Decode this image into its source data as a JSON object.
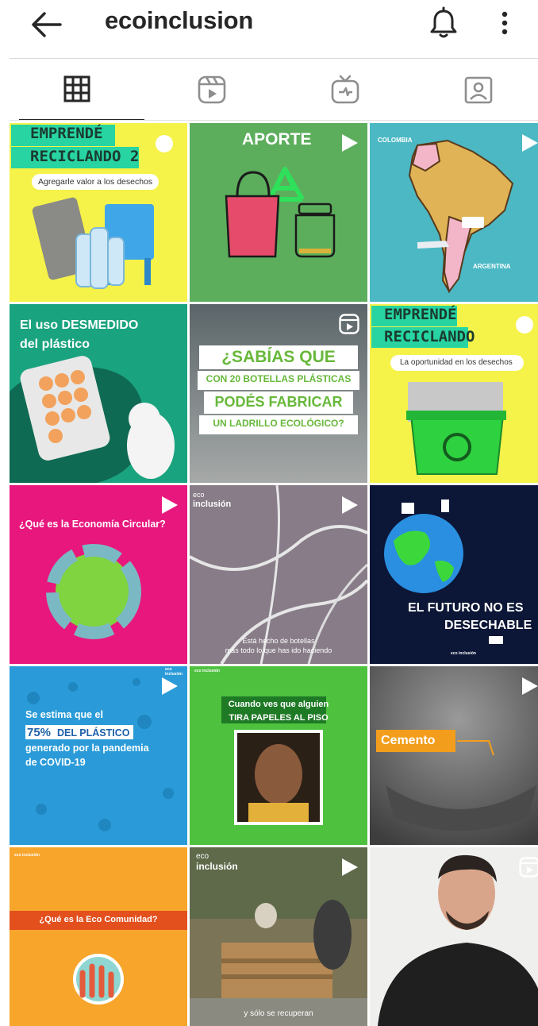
{
  "header": {
    "title": "ecoinclusion"
  },
  "tabs": [
    {
      "name": "grid",
      "active": true
    },
    {
      "name": "reels",
      "active": false
    },
    {
      "name": "igtv",
      "active": false
    },
    {
      "name": "tagged",
      "active": false
    }
  ],
  "posts": {
    "p1": {
      "line1": "EMPRENDÉ",
      "line2": "RECICLANDO 2",
      "sub": "Agregarle valor a los desechos"
    },
    "p2": {
      "title": "APORTE"
    },
    "p3": {
      "top": "COLOMBIA",
      "bottom": "ARGENTINA"
    },
    "p4": {
      "line1": "El uso DESMEDIDO",
      "line2": "del plástico"
    },
    "p5": {
      "l1": "¿SABÍAS QUE",
      "l2": "CON 20 BOTELLAS PLÁSTICAS",
      "l3": "PODÉS FABRICAR",
      "l4": "UN LADRILLO ECOLÓGICO?"
    },
    "p6": {
      "line1": "EMPRENDÉ",
      "line2": "RECICLANDO",
      "sub": "La oportunidad en los desechos"
    },
    "p7": {
      "title": "¿Qué es la Economía Circular?"
    },
    "p8": {
      "logo1": "eco",
      "logo2": "inclusión",
      "cap1": "Está hecho de botellas",
      "cap2": "más todo lo que has ido haciendo"
    },
    "p9": {
      "l1": "EL FUTURO NO ES",
      "l2": "DESECHABLE",
      "logo": "eco inclusión"
    },
    "p10": {
      "t1": "Se estima que el",
      "t2": "75%",
      "t3": "DEL PLÁSTICO",
      "t4": "generado por la pandemia",
      "t5": "de COVID-19",
      "logo": "eco inclusión"
    },
    "p11": {
      "l1": "Cuando ves que alguien",
      "l2": "TIRA PAPELES AL PISO",
      "logo": "eco inclusión"
    },
    "p12": {
      "label": "Cemento"
    },
    "p13": {
      "title": "¿Qué es la Eco Comunidad?",
      "logo": "eco inclusión"
    },
    "p14": {
      "logo1": "eco",
      "logo2": "inclusión",
      "cap": "y sólo se recuperan"
    },
    "p15": {}
  },
  "colors": {
    "yellow": "#f5f24a",
    "green": "#5cae5c",
    "teal": "#4bb8c4",
    "pink": "#e8177d",
    "navy": "#0c1636",
    "blue": "#2a9bd8",
    "lime": "#4ec13e",
    "orange": "#f7a52b"
  }
}
